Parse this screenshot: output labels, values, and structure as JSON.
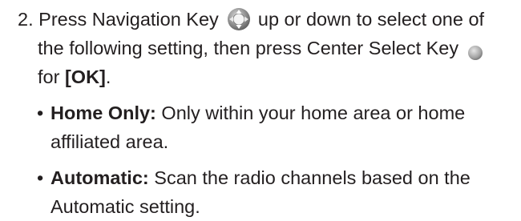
{
  "step": {
    "number": "2.",
    "line1_a": "Press Navigation Key",
    "line1_b": "up or down to select one of",
    "line2": "the following setting, then press Center Select Key",
    "line3_a": "for",
    "line3_ok": "[OK]",
    "line3_end": ".",
    "nav_key_icon": "navigation-key-icon",
    "center_key_icon": "center-select-key-icon"
  },
  "options": [
    {
      "bullet": "•",
      "title": "Home Only:",
      "line1": "Only within your home area or home",
      "line2": "affiliated area."
    },
    {
      "bullet": "•",
      "title": "Automatic:",
      "line1": "Scan the radio channels based on the",
      "line2": "Automatic setting."
    }
  ],
  "colors": {
    "text": "#231f20",
    "key_grey": "#8a8a8a"
  }
}
